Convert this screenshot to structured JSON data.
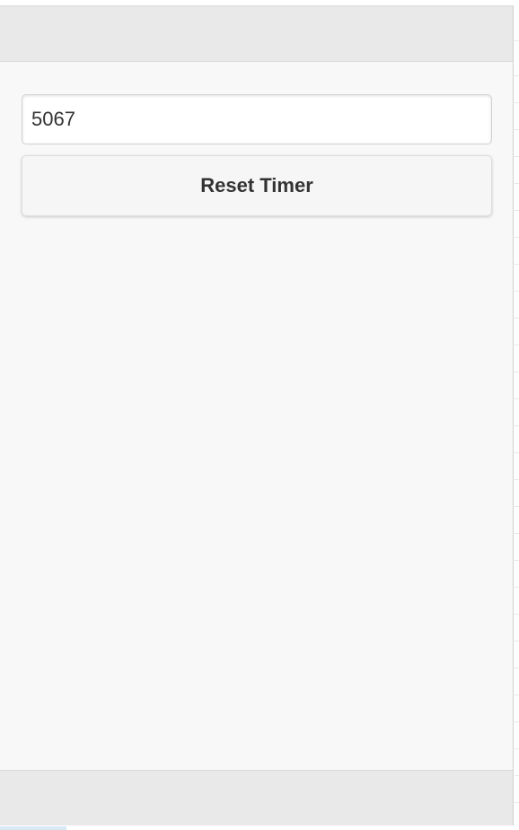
{
  "timer": {
    "value": "5067"
  },
  "actions": {
    "reset_label": "Reset Timer"
  }
}
